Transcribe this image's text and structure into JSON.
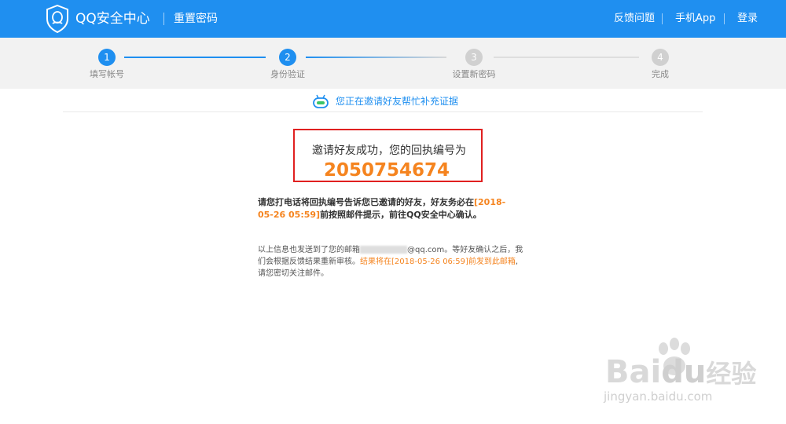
{
  "header": {
    "brand": "QQ安全中心",
    "subtitle": "重置密码",
    "nav": [
      "反馈问题",
      "手机App",
      "登录"
    ]
  },
  "steps": [
    {
      "number": "1",
      "label": "填写帐号",
      "state": "done"
    },
    {
      "number": "2",
      "label": "身份验证",
      "state": "active"
    },
    {
      "number": "3",
      "label": "设置新密码",
      "state": "todo"
    },
    {
      "number": "4",
      "label": "完成",
      "state": "todo"
    }
  ],
  "notice": {
    "text": "您正在邀请好友帮忙补充证据"
  },
  "result": {
    "message": "邀请好友成功，您的回执编号为",
    "receipt_number": "2050754674"
  },
  "instructions": {
    "part1": "请您打电话将回执编号告诉您已邀请的好友，好友务必在",
    "deadline": "[2018-05-26 05:59]",
    "part2": "前按照邮件提示，前往QQ安全中心确认。"
  },
  "info": {
    "part1": "以上信息也发送到了您的邮箱",
    "email_suffix": "@qq.com。等好友确认之后，我们会根据反馈结果重新审核。",
    "result_note": "结果将在[2018-05-26 06:59]前发到此邮箱",
    "part3": ",请您密切关注邮件。"
  },
  "watermark": {
    "brand": "Bai",
    "brand2": "du",
    "brand3": "经验",
    "url": "jingyan.baidu.com"
  },
  "colors": {
    "primary": "#1f8ff0",
    "accent": "#f5841f",
    "alert_border": "#e02020",
    "inactive": "#cccccc"
  }
}
